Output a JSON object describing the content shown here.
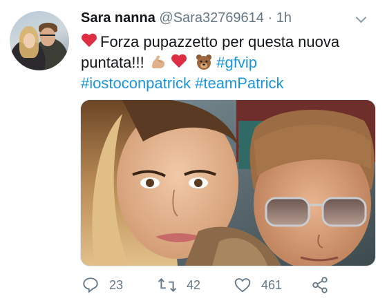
{
  "tweet": {
    "author_name": "Sara nanna",
    "author_handle": "@Sara32769614",
    "separator": "·",
    "timestamp": "1h",
    "text_line1": "Forza pupazzetto per questa nuova",
    "text_line2_start": "puntata!!!",
    "hashtag_gfvip": "#gfvip",
    "hashtag_iostoconpatrick": "#iostoconpatrick",
    "hashtag_teampatrick": "#teamPatrick"
  },
  "actions": {
    "replies": "23",
    "retweets": "42",
    "likes": "461"
  },
  "colors": {
    "text": "#14171a",
    "secondary": "#657786",
    "hashtag": "#1b95e0",
    "heart": "#dd2e44"
  },
  "icons": [
    "heart-emoji",
    "flexed-biceps-emoji",
    "bear-face-emoji",
    "reply-icon",
    "retweet-icon",
    "like-icon",
    "share-icon",
    "chevron-down-icon"
  ]
}
